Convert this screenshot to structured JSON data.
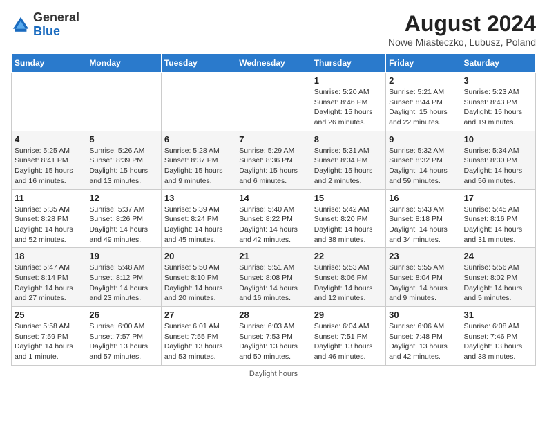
{
  "header": {
    "logo_general": "General",
    "logo_blue": "Blue",
    "month_year": "August 2024",
    "location": "Nowe Miasteczko, Lubusz, Poland"
  },
  "days_of_week": [
    "Sunday",
    "Monday",
    "Tuesday",
    "Wednesday",
    "Thursday",
    "Friday",
    "Saturday"
  ],
  "footer": "Daylight hours",
  "weeks": [
    {
      "days": [
        {
          "num": "",
          "detail": ""
        },
        {
          "num": "",
          "detail": ""
        },
        {
          "num": "",
          "detail": ""
        },
        {
          "num": "",
          "detail": ""
        },
        {
          "num": "1",
          "detail": "Sunrise: 5:20 AM\nSunset: 8:46 PM\nDaylight: 15 hours\nand 26 minutes."
        },
        {
          "num": "2",
          "detail": "Sunrise: 5:21 AM\nSunset: 8:44 PM\nDaylight: 15 hours\nand 22 minutes."
        },
        {
          "num": "3",
          "detail": "Sunrise: 5:23 AM\nSunset: 8:43 PM\nDaylight: 15 hours\nand 19 minutes."
        }
      ]
    },
    {
      "days": [
        {
          "num": "4",
          "detail": "Sunrise: 5:25 AM\nSunset: 8:41 PM\nDaylight: 15 hours\nand 16 minutes."
        },
        {
          "num": "5",
          "detail": "Sunrise: 5:26 AM\nSunset: 8:39 PM\nDaylight: 15 hours\nand 13 minutes."
        },
        {
          "num": "6",
          "detail": "Sunrise: 5:28 AM\nSunset: 8:37 PM\nDaylight: 15 hours\nand 9 minutes."
        },
        {
          "num": "7",
          "detail": "Sunrise: 5:29 AM\nSunset: 8:36 PM\nDaylight: 15 hours\nand 6 minutes."
        },
        {
          "num": "8",
          "detail": "Sunrise: 5:31 AM\nSunset: 8:34 PM\nDaylight: 15 hours\nand 2 minutes."
        },
        {
          "num": "9",
          "detail": "Sunrise: 5:32 AM\nSunset: 8:32 PM\nDaylight: 14 hours\nand 59 minutes."
        },
        {
          "num": "10",
          "detail": "Sunrise: 5:34 AM\nSunset: 8:30 PM\nDaylight: 14 hours\nand 56 minutes."
        }
      ]
    },
    {
      "days": [
        {
          "num": "11",
          "detail": "Sunrise: 5:35 AM\nSunset: 8:28 PM\nDaylight: 14 hours\nand 52 minutes."
        },
        {
          "num": "12",
          "detail": "Sunrise: 5:37 AM\nSunset: 8:26 PM\nDaylight: 14 hours\nand 49 minutes."
        },
        {
          "num": "13",
          "detail": "Sunrise: 5:39 AM\nSunset: 8:24 PM\nDaylight: 14 hours\nand 45 minutes."
        },
        {
          "num": "14",
          "detail": "Sunrise: 5:40 AM\nSunset: 8:22 PM\nDaylight: 14 hours\nand 42 minutes."
        },
        {
          "num": "15",
          "detail": "Sunrise: 5:42 AM\nSunset: 8:20 PM\nDaylight: 14 hours\nand 38 minutes."
        },
        {
          "num": "16",
          "detail": "Sunrise: 5:43 AM\nSunset: 8:18 PM\nDaylight: 14 hours\nand 34 minutes."
        },
        {
          "num": "17",
          "detail": "Sunrise: 5:45 AM\nSunset: 8:16 PM\nDaylight: 14 hours\nand 31 minutes."
        }
      ]
    },
    {
      "days": [
        {
          "num": "18",
          "detail": "Sunrise: 5:47 AM\nSunset: 8:14 PM\nDaylight: 14 hours\nand 27 minutes."
        },
        {
          "num": "19",
          "detail": "Sunrise: 5:48 AM\nSunset: 8:12 PM\nDaylight: 14 hours\nand 23 minutes."
        },
        {
          "num": "20",
          "detail": "Sunrise: 5:50 AM\nSunset: 8:10 PM\nDaylight: 14 hours\nand 20 minutes."
        },
        {
          "num": "21",
          "detail": "Sunrise: 5:51 AM\nSunset: 8:08 PM\nDaylight: 14 hours\nand 16 minutes."
        },
        {
          "num": "22",
          "detail": "Sunrise: 5:53 AM\nSunset: 8:06 PM\nDaylight: 14 hours\nand 12 minutes."
        },
        {
          "num": "23",
          "detail": "Sunrise: 5:55 AM\nSunset: 8:04 PM\nDaylight: 14 hours\nand 9 minutes."
        },
        {
          "num": "24",
          "detail": "Sunrise: 5:56 AM\nSunset: 8:02 PM\nDaylight: 14 hours\nand 5 minutes."
        }
      ]
    },
    {
      "days": [
        {
          "num": "25",
          "detail": "Sunrise: 5:58 AM\nSunset: 7:59 PM\nDaylight: 14 hours\nand 1 minute."
        },
        {
          "num": "26",
          "detail": "Sunrise: 6:00 AM\nSunset: 7:57 PM\nDaylight: 13 hours\nand 57 minutes."
        },
        {
          "num": "27",
          "detail": "Sunrise: 6:01 AM\nSunset: 7:55 PM\nDaylight: 13 hours\nand 53 minutes."
        },
        {
          "num": "28",
          "detail": "Sunrise: 6:03 AM\nSunset: 7:53 PM\nDaylight: 13 hours\nand 50 minutes."
        },
        {
          "num": "29",
          "detail": "Sunrise: 6:04 AM\nSunset: 7:51 PM\nDaylight: 13 hours\nand 46 minutes."
        },
        {
          "num": "30",
          "detail": "Sunrise: 6:06 AM\nSunset: 7:48 PM\nDaylight: 13 hours\nand 42 minutes."
        },
        {
          "num": "31",
          "detail": "Sunrise: 6:08 AM\nSunset: 7:46 PM\nDaylight: 13 hours\nand 38 minutes."
        }
      ]
    }
  ]
}
